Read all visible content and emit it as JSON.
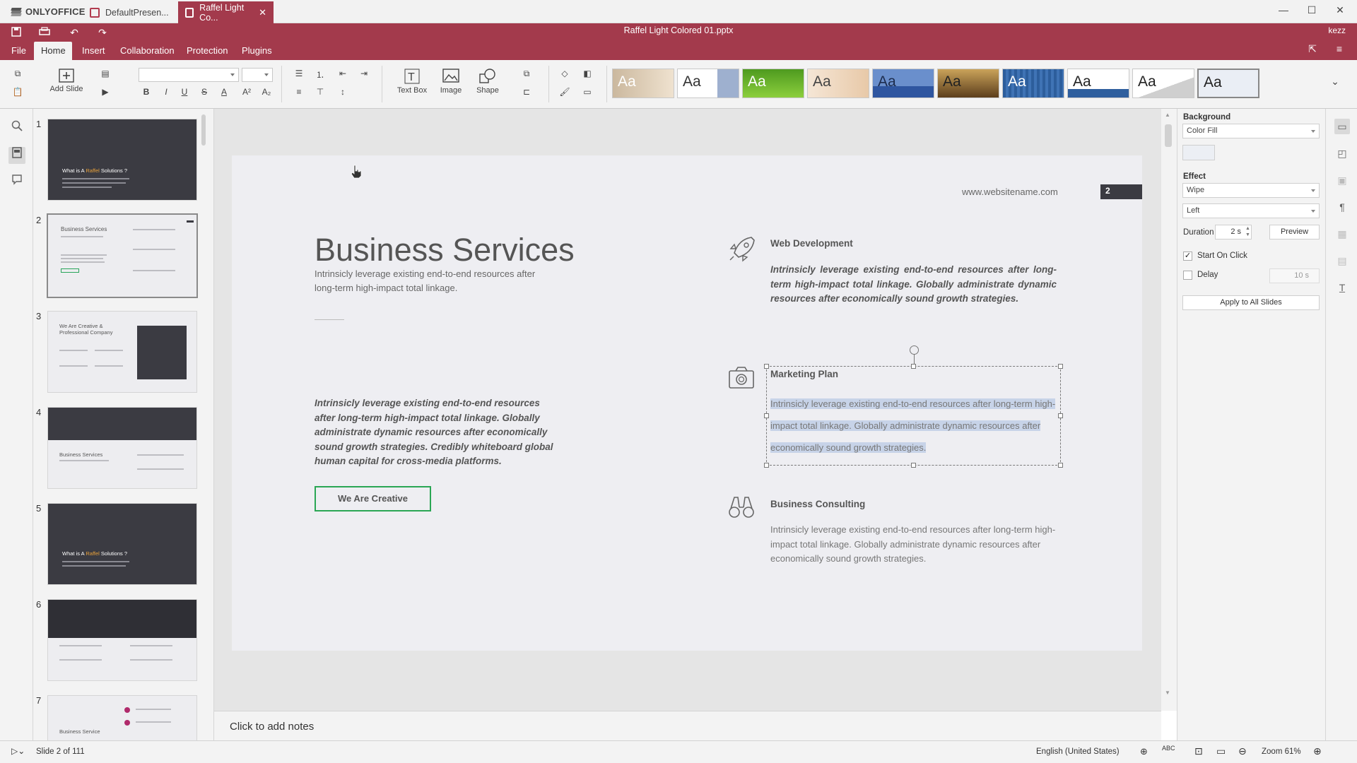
{
  "window": {
    "app_name": "ONLYOFFICE",
    "tabs": [
      {
        "label": "DefaultPresen...",
        "active": false
      },
      {
        "label": "Raffel Light Co...",
        "active": true
      }
    ],
    "minimize_icon": "minimize-icon",
    "maximize_icon": "maximize-icon",
    "close_icon": "close-icon"
  },
  "header": {
    "doc_title": "Raffel Light Colored 01.pptx",
    "user": "kezz",
    "menu": [
      "File",
      "Home",
      "Insert",
      "Collaboration",
      "Protection",
      "Plugins"
    ],
    "active_menu": "Home",
    "accent_color": "#a33a4c"
  },
  "toolbar": {
    "add_slide": "Add Slide",
    "text_box": "Text Box",
    "image": "Image",
    "shape": "Shape",
    "themes": [
      {
        "label": "Aa",
        "bg": "#d8c9b4",
        "fg": "#f5f0e8"
      },
      {
        "label": "Aa",
        "bg": "#ffffff",
        "fg": "#333333"
      },
      {
        "label": "Aa",
        "bg": "#5fa626",
        "fg": "#ffffff"
      },
      {
        "label": "Aa",
        "bg": "#f3e1cf",
        "fg": "#555555"
      },
      {
        "label": "Aa",
        "bg": "#3a62a8",
        "fg": "#222222"
      },
      {
        "label": "Aa",
        "bg": "#7d5a2e",
        "fg": "#222222"
      },
      {
        "label": "Aa",
        "bg": "#2f5f9e",
        "fg": "#ffffff"
      },
      {
        "label": "Aa",
        "bg": "#ffffff",
        "fg": "#222222"
      },
      {
        "label": "Aa",
        "bg": "#f2f2f2",
        "fg": "#222222"
      },
      {
        "label": "Aa",
        "bg": "#eaeef5",
        "fg": "#222222"
      }
    ]
  },
  "thumbnails": {
    "items": [
      {
        "num": "1",
        "title_pre": "What is A ",
        "title_accent": "Raffel",
        "title_post": " Solutions ?",
        "dark": true
      },
      {
        "num": "2",
        "title": "Business Services",
        "dark": false,
        "selected": true
      },
      {
        "num": "3",
        "title": "We Are Creative & Professional Company",
        "dark": false
      },
      {
        "num": "4",
        "title": "Business Services",
        "dark": true
      },
      {
        "num": "5",
        "title_pre": "What is A ",
        "title_accent": "Raffel",
        "title_post": " Solutions ?",
        "dark": true
      },
      {
        "num": "6",
        "title": "",
        "dark": true
      },
      {
        "num": "7",
        "title": "Business Service",
        "dark": false
      }
    ]
  },
  "slide": {
    "website": "www.websitename.com",
    "page_number": "2",
    "title": "Business Services",
    "subtitle": "Intrinsicly leverage existing end-to-end resources after long-term high-impact total linkage.",
    "italic_block": "Intrinsicly leverage existing end-to-end resources after long-term high-impact total linkage. Globally administrate dynamic resources after economically sound growth strategies. Credibly whiteboard global human capital for cross-media platforms.",
    "button": "We Are Creative",
    "services": [
      {
        "icon": "rocket-icon",
        "heading": "Web Development",
        "body": "Intrinsicly leverage existing end-to-end resources after long-term high-impact total linkage. Globally administrate dynamic resources after economically sound growth strategies."
      },
      {
        "icon": "camera-icon",
        "heading": "Marketing Plan",
        "body": "Intrinsicly leverage existing end-to-end resources after long-term high-impact total linkage. Globally administrate dynamic resources after economically sound growth strategies."
      },
      {
        "icon": "binoculars-icon",
        "heading": "Business Consulting",
        "body": "Intrinsicly leverage existing end-to-end resources after long-term high-impact total linkage. Globally administrate dynamic resources after economically sound growth strategies."
      }
    ]
  },
  "notes": {
    "placeholder": "Click to add notes"
  },
  "right_panel": {
    "background_label": "Background",
    "background_value": "Color Fill",
    "effect_label": "Effect",
    "effect_value": "Wipe",
    "direction_value": "Left",
    "duration_label": "Duration",
    "duration_value": "2 s",
    "preview_button": "Preview",
    "start_on_click_label": "Start On Click",
    "start_on_click_checked": true,
    "delay_label": "Delay",
    "delay_value": "10 s",
    "delay_checked": false,
    "apply_all_button": "Apply to All Slides"
  },
  "status": {
    "slide_counter": "Slide 2 of 111",
    "language": "English (United States)",
    "zoom": "Zoom 61%"
  }
}
